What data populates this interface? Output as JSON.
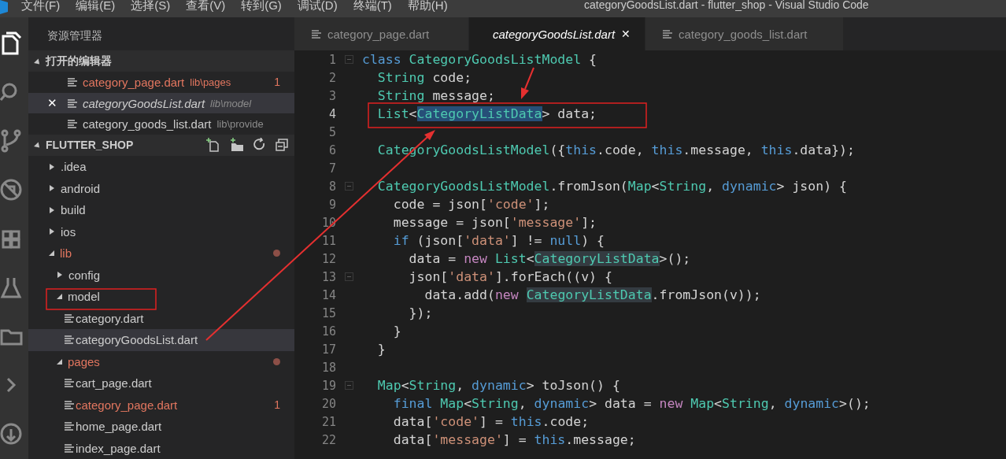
{
  "window": {
    "title": "categoryGoodsList.dart - flutter_shop - Visual Studio Code"
  },
  "menu": [
    "文件(F)",
    "编辑(E)",
    "选择(S)",
    "查看(V)",
    "转到(G)",
    "调试(D)",
    "终端(T)",
    "帮助(H)"
  ],
  "activity_bar": [
    {
      "kind": "files",
      "selected": true
    },
    {
      "kind": "search",
      "selected": false
    },
    {
      "kind": "git",
      "selected": false
    },
    {
      "kind": "debug",
      "selected": false
    },
    {
      "kind": "extensions",
      "selected": false
    },
    {
      "kind": "flask",
      "selected": false
    },
    {
      "kind": "folder",
      "selected": false
    },
    {
      "kind": "chevron",
      "selected": false
    },
    {
      "kind": "remote",
      "selected": false
    }
  ],
  "explorer": {
    "title": "资源管理器",
    "open_editors": {
      "title": "打开的编辑器",
      "expanded": true,
      "items": [
        {
          "name": "category_page.dart",
          "path": "lib\\pages",
          "badge": "1",
          "modified": true,
          "preview": false,
          "selected": false
        },
        {
          "name": "categoryGoodsList.dart",
          "path": "lib\\model",
          "close": "✕",
          "modified": false,
          "preview": true,
          "selected": true
        },
        {
          "name": "category_goods_list.dart",
          "path": "lib\\provide",
          "modified": false,
          "preview": false,
          "selected": false
        }
      ]
    },
    "project": {
      "title": "FLUTTER_SHOP",
      "expanded": true
    },
    "tree": [
      {
        "name": ".idea",
        "kind": "folder",
        "expanded": false,
        "modified": false,
        "selected": false
      },
      {
        "name": "android",
        "kind": "folder",
        "expanded": false,
        "modified": false,
        "selected": false
      },
      {
        "name": "build",
        "kind": "folder",
        "expanded": false,
        "modified": false,
        "selected": false
      },
      {
        "name": "ios",
        "kind": "folder",
        "expanded": false,
        "modified": false,
        "selected": false
      },
      {
        "name": "lib",
        "kind": "folder",
        "expanded": true,
        "modified": true,
        "selected": false,
        "children": [
          {
            "name": "config",
            "kind": "folder",
            "expanded": false,
            "modified": false,
            "selected": false
          },
          {
            "name": "model",
            "kind": "folder",
            "expanded": true,
            "modified": false,
            "selected": false,
            "children": [
              {
                "name": "category.dart",
                "kind": "file",
                "modified": false,
                "selected": false
              },
              {
                "name": "categoryGoodsList.dart",
                "kind": "file",
                "modified": false,
                "selected": true
              }
            ]
          },
          {
            "name": "pages",
            "kind": "folder",
            "expanded": true,
            "modified": true,
            "selected": false,
            "children": [
              {
                "name": "cart_page.dart",
                "kind": "file",
                "modified": false,
                "selected": false
              },
              {
                "name": "category_page.dart",
                "kind": "file",
                "modified": true,
                "badge": "1",
                "selected": false
              },
              {
                "name": "home_page.dart",
                "kind": "file",
                "modified": false,
                "selected": false
              },
              {
                "name": "index_page.dart",
                "kind": "file",
                "modified": false,
                "selected": false
              }
            ]
          }
        ]
      }
    ]
  },
  "tabs": [
    {
      "label": "category_page.dart",
      "selected": false,
      "preview": false
    },
    {
      "label": "categoryGoodsList.dart",
      "selected": true,
      "preview": true,
      "close": "✕"
    },
    {
      "label": "category_goods_list.dart",
      "selected": false,
      "preview": false
    }
  ],
  "code": [
    {
      "n": "1",
      "fold": true,
      "current": false,
      "tokens": [
        {
          "text": "class ",
          "kind": "kw"
        },
        {
          "text": "CategoryGoodsListModel",
          "kind": "type"
        },
        {
          "text": " {",
          "kind": "plain"
        }
      ]
    },
    {
      "n": "2",
      "fold": false,
      "current": false,
      "tokens": [
        {
          "text": "  String",
          "kind": "type"
        },
        {
          "text": " code;",
          "kind": "plain"
        }
      ]
    },
    {
      "n": "3",
      "fold": false,
      "current": false,
      "tokens": [
        {
          "text": "  String",
          "kind": "type"
        },
        {
          "text": " message;",
          "kind": "plain"
        }
      ]
    },
    {
      "n": "4",
      "fold": false,
      "current": true,
      "tokens": [
        {
          "text": "  List",
          "kind": "type"
        },
        {
          "text": "<",
          "kind": "plain"
        },
        {
          "text": "CategoryListData",
          "kind": "sel"
        },
        {
          "text": "> data;",
          "kind": "plain"
        }
      ]
    },
    {
      "n": "5",
      "fold": false,
      "current": false
    },
    {
      "n": "6",
      "fold": false,
      "current": false,
      "tokens": [
        {
          "text": "  CategoryGoodsListModel",
          "kind": "type"
        },
        {
          "text": "({",
          "kind": "plain"
        },
        {
          "text": "this",
          "kind": "kw"
        },
        {
          "text": ".code, ",
          "kind": "plain"
        },
        {
          "text": "this",
          "kind": "kw"
        },
        {
          "text": ".message, ",
          "kind": "plain"
        },
        {
          "text": "this",
          "kind": "kw"
        },
        {
          "text": ".data});",
          "kind": "plain"
        }
      ]
    },
    {
      "n": "7",
      "fold": false,
      "current": false
    },
    {
      "n": "8",
      "fold": true,
      "current": false,
      "tokens": [
        {
          "text": "  CategoryGoodsListModel",
          "kind": "type"
        },
        {
          "text": ".fromJson(",
          "kind": "plain"
        },
        {
          "text": "Map",
          "kind": "type"
        },
        {
          "text": "<",
          "kind": "plain"
        },
        {
          "text": "String",
          "kind": "type"
        },
        {
          "text": ", ",
          "kind": "plain"
        },
        {
          "text": "dynamic",
          "kind": "kw"
        },
        {
          "text": "> json) {",
          "kind": "plain"
        }
      ]
    },
    {
      "n": "9",
      "fold": false,
      "current": false,
      "tokens": [
        {
          "text": "    code = json[",
          "kind": "plain"
        },
        {
          "text": "'code'",
          "kind": "str"
        },
        {
          "text": "];",
          "kind": "plain"
        }
      ]
    },
    {
      "n": "10",
      "fold": false,
      "current": false,
      "tokens": [
        {
          "text": "    message = json[",
          "kind": "plain"
        },
        {
          "text": "'message'",
          "kind": "str"
        },
        {
          "text": "];",
          "kind": "plain"
        }
      ]
    },
    {
      "n": "11",
      "fold": false,
      "current": false,
      "tokens": [
        {
          "text": "    if",
          "kind": "kw"
        },
        {
          "text": " (json[",
          "kind": "plain"
        },
        {
          "text": "'data'",
          "kind": "str"
        },
        {
          "text": "] != ",
          "kind": "plain"
        },
        {
          "text": "null",
          "kind": "kw"
        },
        {
          "text": ") {",
          "kind": "plain"
        }
      ]
    },
    {
      "n": "12",
      "fold": false,
      "current": false,
      "tokens": [
        {
          "text": "      data = ",
          "kind": "plain"
        },
        {
          "text": "new ",
          "kind": "new"
        },
        {
          "text": "List",
          "kind": "type"
        },
        {
          "text": "<",
          "kind": "plain"
        },
        {
          "text": "CategoryListData",
          "kind": "ref"
        },
        {
          "text": ">();",
          "kind": "plain"
        }
      ]
    },
    {
      "n": "13",
      "fold": true,
      "current": false,
      "tokens": [
        {
          "text": "      json[",
          "kind": "plain"
        },
        {
          "text": "'data'",
          "kind": "str"
        },
        {
          "text": "].forEach((v) {",
          "kind": "plain"
        }
      ]
    },
    {
      "n": "14",
      "fold": false,
      "current": false,
      "tokens": [
        {
          "text": "        data.add(",
          "kind": "plain"
        },
        {
          "text": "new ",
          "kind": "new"
        },
        {
          "text": "CategoryListData",
          "kind": "ref"
        },
        {
          "text": ".fromJson(v));",
          "kind": "plain"
        }
      ]
    },
    {
      "n": "15",
      "fold": false,
      "current": false,
      "tokens": [
        {
          "text": "      });",
          "kind": "plain"
        }
      ]
    },
    {
      "n": "16",
      "fold": false,
      "current": false,
      "tokens": [
        {
          "text": "    }",
          "kind": "plain"
        }
      ]
    },
    {
      "n": "17",
      "fold": false,
      "current": false,
      "tokens": [
        {
          "text": "  }",
          "kind": "plain"
        }
      ]
    },
    {
      "n": "18",
      "fold": false,
      "current": false
    },
    {
      "n": "19",
      "fold": true,
      "current": false,
      "tokens": [
        {
          "text": "  Map",
          "kind": "type"
        },
        {
          "text": "<",
          "kind": "plain"
        },
        {
          "text": "String",
          "kind": "type"
        },
        {
          "text": ", ",
          "kind": "plain"
        },
        {
          "text": "dynamic",
          "kind": "kw"
        },
        {
          "text": "> toJson() {",
          "kind": "plain"
        }
      ]
    },
    {
      "n": "20",
      "fold": false,
      "current": false,
      "tokens": [
        {
          "text": "    final ",
          "kind": "kw"
        },
        {
          "text": "Map",
          "kind": "type"
        },
        {
          "text": "<",
          "kind": "plain"
        },
        {
          "text": "String",
          "kind": "type"
        },
        {
          "text": ", ",
          "kind": "plain"
        },
        {
          "text": "dynamic",
          "kind": "kw"
        },
        {
          "text": "> data = ",
          "kind": "plain"
        },
        {
          "text": "new ",
          "kind": "new"
        },
        {
          "text": "Map",
          "kind": "type"
        },
        {
          "text": "<",
          "kind": "plain"
        },
        {
          "text": "String",
          "kind": "type"
        },
        {
          "text": ", ",
          "kind": "plain"
        },
        {
          "text": "dynamic",
          "kind": "kw"
        },
        {
          "text": ">();",
          "kind": "plain"
        }
      ]
    },
    {
      "n": "21",
      "fold": false,
      "current": false,
      "tokens": [
        {
          "text": "    data[",
          "kind": "plain"
        },
        {
          "text": "'code'",
          "kind": "str"
        },
        {
          "text": "] = ",
          "kind": "plain"
        },
        {
          "text": "this",
          "kind": "kw"
        },
        {
          "text": ".code;",
          "kind": "plain"
        }
      ]
    },
    {
      "n": "22",
      "fold": false,
      "current": false,
      "tokens": [
        {
          "text": "    data[",
          "kind": "plain"
        },
        {
          "text": "'message'",
          "kind": "str"
        },
        {
          "text": "] = ",
          "kind": "plain"
        },
        {
          "text": "this",
          "kind": "kw"
        },
        {
          "text": ".message;",
          "kind": "plain"
        }
      ]
    }
  ]
}
